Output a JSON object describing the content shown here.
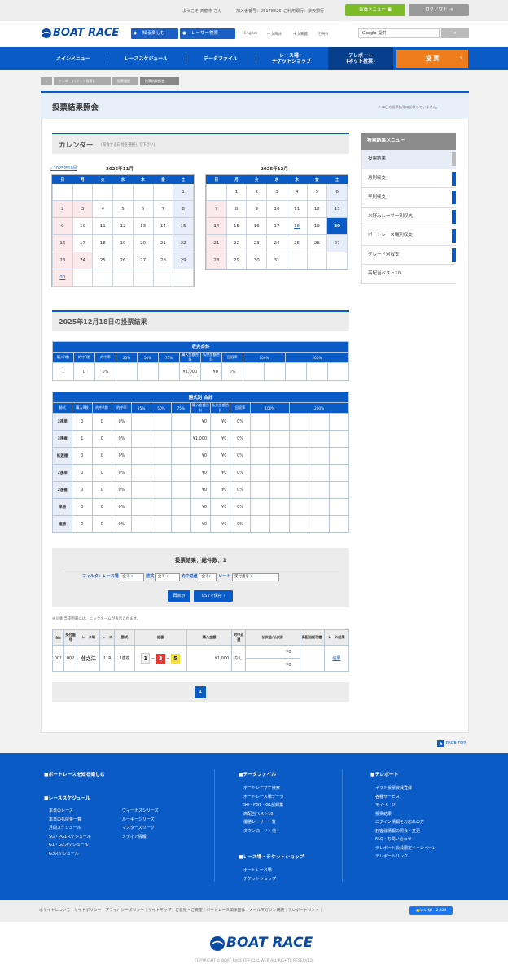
{
  "topbar": {
    "welcome": "ようこそ 天龍寺 さん",
    "member_no": "加入者番号：05178826",
    "bank": "ご利用銀行：楽天銀行",
    "member_menu": "会員メニュー",
    "logout": "ログアウト"
  },
  "header": {
    "logo": "BOAT RACE",
    "pill1": "知る楽しむ",
    "pill2": "レーサー検索",
    "langs": [
      "English",
      "中文简体",
      "中文繁體",
      "한국어"
    ],
    "search_label": "Google 提供"
  },
  "nav": {
    "items": [
      "メインメニュー",
      "レーススケジュール",
      "データファイル",
      "レース場・\nチケットショップ",
      "テレボート\n(ネット投票)"
    ],
    "vote": "投 票"
  },
  "breadcrumb": [
    "テレボート(ネット投票)",
    "投票履歴",
    "投票結果照会"
  ],
  "page": {
    "title": "投票結果照会",
    "note": "※ 本日の投票結果は反映していません。"
  },
  "calendar": {
    "heading": "カレンダー",
    "hint": "(照会する日付を選択して下さい)",
    "prev": "2025年10月",
    "weekdays": [
      "日",
      "月",
      "火",
      "水",
      "木",
      "金",
      "土"
    ],
    "months": [
      {
        "label": "2025年11月",
        "rows": [
          [
            "",
            "",
            "",
            "",
            "",
            "",
            "1"
          ],
          [
            "2",
            "3",
            "4",
            "5",
            "6",
            "7",
            "8"
          ],
          [
            "9",
            "10",
            "11",
            "12",
            "13",
            "14",
            "15"
          ],
          [
            "16",
            "17",
            "18",
            "19",
            "20",
            "21",
            "22"
          ],
          [
            "23",
            "24",
            "25",
            "26",
            "27",
            "28",
            "29"
          ],
          [
            "30",
            "",
            "",
            "",
            "",
            "",
            ""
          ]
        ]
      },
      {
        "label": "2025年12月",
        "rows": [
          [
            "",
            "1",
            "2",
            "3",
            "4",
            "5",
            "6"
          ],
          [
            "7",
            "8",
            "9",
            "10",
            "11",
            "12",
            "13"
          ],
          [
            "14",
            "15",
            "16",
            "17",
            "18",
            "19",
            "20"
          ],
          [
            "21",
            "22",
            "23",
            "24",
            "25",
            "26",
            "27"
          ],
          [
            "28",
            "29",
            "30",
            "31",
            "",
            "",
            ""
          ]
        ]
      }
    ]
  },
  "side_menu": {
    "title": "投票結果メニュー",
    "items": [
      "投票結果",
      "月別収支",
      "年別収支",
      "お好みレーサー別収支",
      "ボートレース場別収支",
      "グレード別収支",
      "高配当ベスト10"
    ]
  },
  "results": {
    "heading": "2025年12月18日の投票結果",
    "summary": {
      "caption": "収支合計",
      "headers": [
        "購入R数",
        "的中R数",
        "的中率",
        "25%",
        "50%",
        "75%",
        "購入金額合計",
        "払戻金額合計",
        "回収率",
        "100%",
        "200%"
      ],
      "row": [
        "1",
        "0",
        "0%",
        "¥1,000",
        "¥0",
        "0%"
      ]
    },
    "by_type": {
      "caption": "勝式別 合計",
      "headers": [
        "勝式",
        "購入R数",
        "的中R数",
        "的中率",
        "25%",
        "50%",
        "75%",
        "購入金額合計",
        "払戻金額合計",
        "回収率",
        "100%",
        "200%"
      ],
      "rows": [
        [
          "3連単",
          "0",
          "0",
          "0%",
          "¥0",
          "¥0",
          "0%"
        ],
        [
          "3連複",
          "1",
          "0",
          "0%",
          "¥1,000",
          "¥0",
          "0%"
        ],
        [
          "拡連複",
          "0",
          "0",
          "0%",
          "¥0",
          "¥0",
          "0%"
        ],
        [
          "2連単",
          "0",
          "0",
          "0%",
          "¥0",
          "¥0",
          "0%"
        ],
        [
          "2連複",
          "0",
          "0",
          "0%",
          "¥0",
          "¥0",
          "0%"
        ],
        [
          "単勝",
          "0",
          "0",
          "0%",
          "¥0",
          "¥0",
          "0%"
        ],
        [
          "複勝",
          "0",
          "0",
          "0%",
          "¥0",
          "¥0",
          "0%"
        ]
      ]
    }
  },
  "filter": {
    "title": "投票結果：総件数：1",
    "label_venue": "フィルタ：レース場",
    "venue_value": "全て",
    "label_type": "勝式",
    "type_value": "全て",
    "label_hit": "的中返還",
    "hit_value": "全て",
    "label_sort": "ソート",
    "sort_value": "受付番号",
    "redisplay": "再表示",
    "csv": "CSVで保存"
  },
  "list_note": "※ 同配当証明書には、ニックネームが表示されます。",
  "detail": {
    "headers": [
      "No",
      "受付番号",
      "レース場",
      "レース",
      "勝式",
      "組番",
      "購入金額",
      "的中返還",
      "払戻金/払戻計",
      "高配当証明書",
      "レース結果"
    ],
    "row": {
      "no": "001",
      "receipt": "002",
      "venue": "住之江",
      "race": "11R",
      "type": "3連複",
      "combo": [
        "1",
        "3",
        "5"
      ],
      "amount": "¥1,000",
      "hit": "なし",
      "payout1": "¥0",
      "payout2": "¥0",
      "result": "結果"
    }
  },
  "pager": {
    "page": "1"
  },
  "page_top": "PAGE TOP",
  "footer": {
    "col1_h1": "■ボートレースを知る楽しむ",
    "col1_h2": "■レーススケジュール",
    "col1_links_a": [
      "本日のレース",
      "本日の払戻金一覧",
      "月間スケジュール",
      "SG・PG1スケジュール",
      "G1・G2スケジュール",
      "G3スケジュール"
    ],
    "col1_links_b": [
      "ヴィーナスシリーズ",
      "ルーキーシリーズ",
      "マスターズリーグ",
      "メディア情報"
    ],
    "col2_h1": "■データファイル",
    "col2_links": [
      "ボートレーサー検索",
      "ボートレース場データ",
      "SG・PG1・G1記録集",
      "高配当ベスト10",
      "優勝レーサー一覧",
      "ダウンロード・他"
    ],
    "col2_h2": "■レース場・チケットショップ",
    "col2_links2": [
      "ボートレース場",
      "チケットショップ"
    ],
    "col3_h": "■テレボート",
    "col3_links": [
      "ネット投票会員登録",
      "各種サービス",
      "マイページ",
      "投票結果",
      "ログイン情報をお忘れの方",
      "お客様情報の照会・変更",
      "FAQ・お問い合わせ",
      "テレボート会員限定キャンペーン",
      "テレボートリンク"
    ]
  },
  "bottom_links": [
    "本サイトについて",
    "サイトポリシー",
    "プライバシーポリシー",
    "サイトマップ",
    "ご意見・ご要望",
    "ボートレース関係団体",
    "メールマガジン購読",
    "テレボートリンク"
  ],
  "like": "いいね！ 2,324",
  "copyright": "COPYRIGHT © BOAT RACE OFFICIAL WEB ALL RIGHTS RESERVED."
}
